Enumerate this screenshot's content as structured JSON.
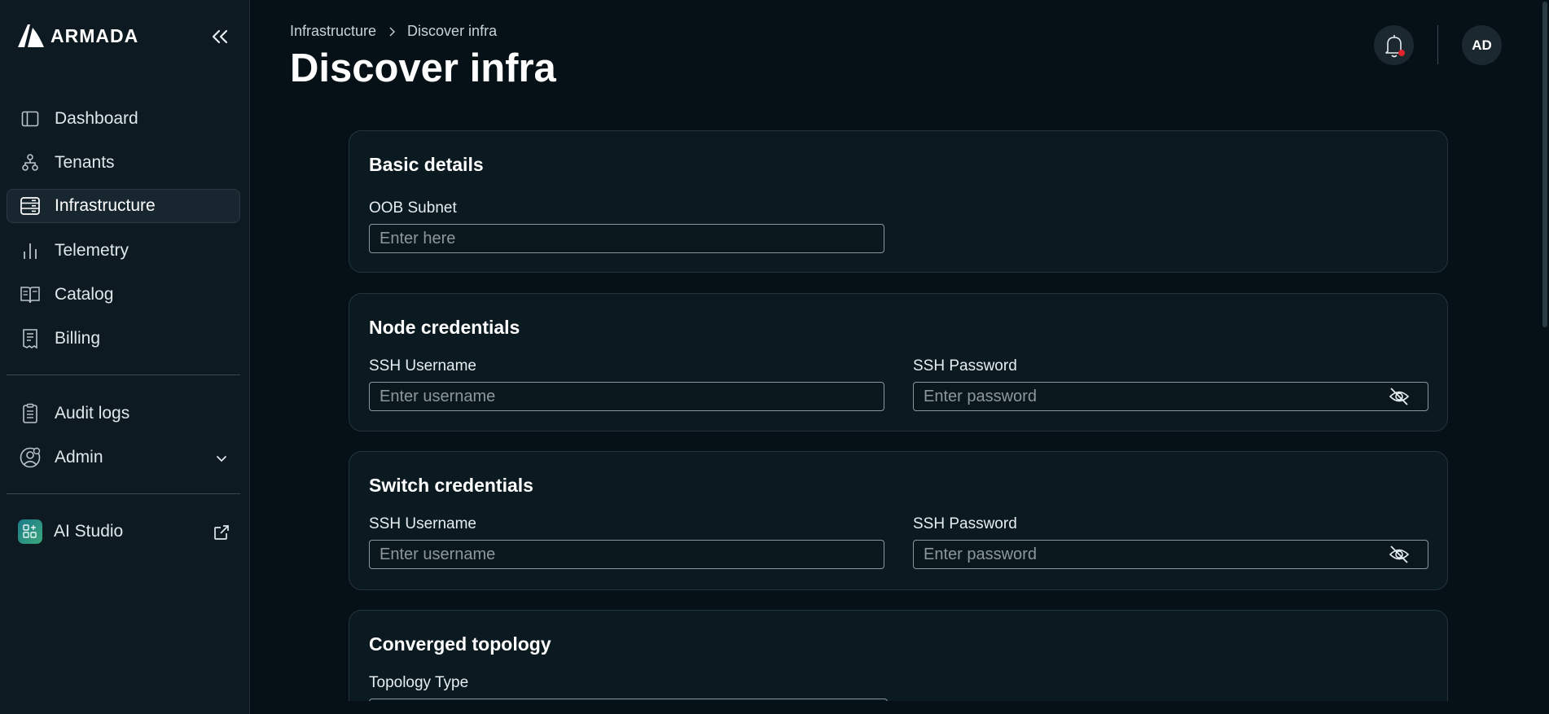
{
  "app": {
    "logo_text": "ARMADA"
  },
  "sidebar": {
    "items": [
      {
        "label": "Dashboard",
        "icon": "dashboard-icon"
      },
      {
        "label": "Tenants",
        "icon": "tenants-icon"
      },
      {
        "label": "Infrastructure",
        "icon": "server-icon",
        "active": true
      },
      {
        "label": "Telemetry",
        "icon": "bar-chart-icon"
      },
      {
        "label": "Catalog",
        "icon": "book-icon"
      },
      {
        "label": "Billing",
        "icon": "receipt-icon"
      }
    ],
    "secondary": [
      {
        "label": "Audit logs",
        "icon": "clipboard-icon"
      },
      {
        "label": "Admin",
        "icon": "user-gear-icon"
      }
    ],
    "ai_studio": {
      "label": "AI Studio",
      "icon": "apps-icon"
    }
  },
  "header": {
    "breadcrumb": [
      "Infrastructure",
      "Discover infra"
    ],
    "title": "Discover infra",
    "avatar_initials": "AD"
  },
  "cards": {
    "basic": {
      "title": "Basic details",
      "oob_label": "OOB Subnet",
      "oob_placeholder": "Enter here"
    },
    "node": {
      "title": "Node credentials",
      "user_label": "SSH Username",
      "user_placeholder": "Enter username",
      "pass_label": "SSH Password",
      "pass_placeholder": "Enter password"
    },
    "switch": {
      "title": "Switch credentials",
      "user_label": "SSH Username",
      "user_placeholder": "Enter username",
      "pass_label": "SSH Password",
      "pass_placeholder": "Enter password"
    },
    "topology": {
      "title": "Converged topology",
      "type_label": "Topology Type"
    }
  },
  "colors": {
    "background": "#061117",
    "sidebar": "#0d1a21",
    "card": "#0b1a20",
    "notification_dot": "#e0242b"
  }
}
